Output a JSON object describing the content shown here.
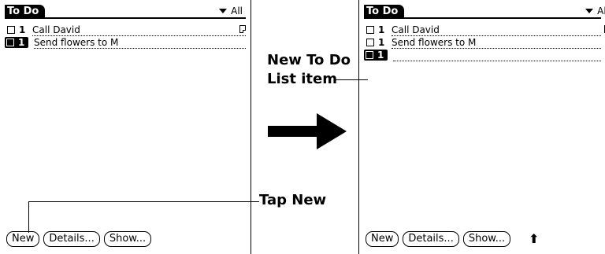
{
  "left_screen": {
    "title": "To Do",
    "category": "All",
    "items": [
      {
        "priority": "1",
        "text": "Call David",
        "selected": false,
        "note": true
      },
      {
        "priority": "1",
        "text": "Send flowers to M",
        "selected": true,
        "note": false
      }
    ],
    "buttons": [
      "New",
      "Details...",
      "Show..."
    ]
  },
  "right_screen": {
    "title": "To Do",
    "category": "All",
    "items": [
      {
        "priority": "1",
        "text": "Call David",
        "selected": false,
        "note": true
      },
      {
        "priority": "1",
        "text": "Send flowers to M",
        "selected": false,
        "note": false
      },
      {
        "priority": "1",
        "text": "",
        "selected": true,
        "note": false
      }
    ],
    "buttons": [
      "New",
      "Details...",
      "Show..."
    ],
    "scroll_arrow": "up-arrow-icon"
  },
  "callouts": {
    "new_item": "New To Do List item",
    "tap_new": "Tap New"
  }
}
